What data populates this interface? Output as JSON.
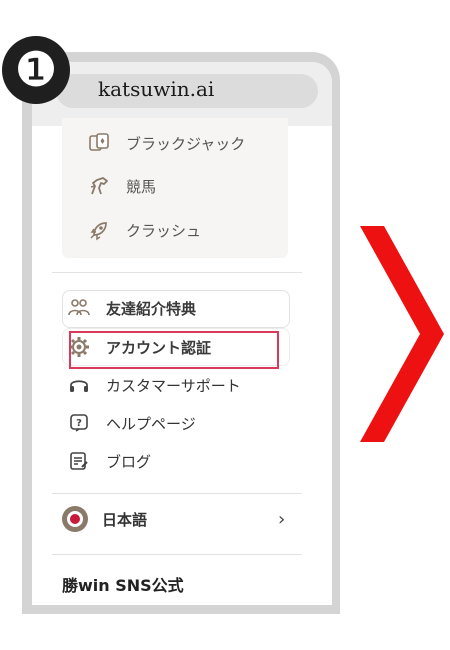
{
  "step": {
    "number": "❶"
  },
  "browser": {
    "url": "katsuwin.ai"
  },
  "games": [
    {
      "label": "ブラックジャック",
      "icon": "cards-icon"
    },
    {
      "label": "競馬",
      "icon": "horse-icon"
    },
    {
      "label": "クラッシュ",
      "icon": "rocket-icon"
    }
  ],
  "menu": [
    {
      "label": "友達紹介特典",
      "icon": "users-icon"
    },
    {
      "label": "アカウント認証",
      "icon": "gear-icon"
    },
    {
      "label": "カスタマーサポート",
      "icon": "headphones-icon"
    },
    {
      "label": "ヘルプページ",
      "icon": "help-icon"
    },
    {
      "label": "ブログ",
      "icon": "blog-icon"
    }
  ],
  "language": {
    "label": "日本語",
    "chevron": "›"
  },
  "footer": {
    "label": "勝win SNS公式"
  },
  "colors": {
    "highlight": "#d93a5a",
    "arrow": "#ee1111",
    "icon": "#8a7a6a"
  }
}
